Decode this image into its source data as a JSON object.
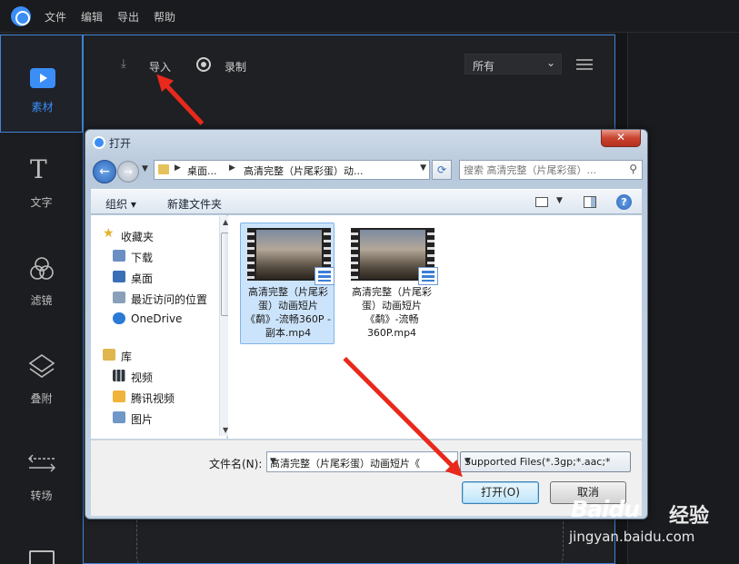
{
  "menubar": {
    "items": [
      "文件",
      "编辑",
      "导出",
      "帮助"
    ]
  },
  "sidebar": {
    "items": [
      {
        "label": "素材",
        "icon": "material-icon",
        "active": true
      },
      {
        "label": "文字",
        "icon": "text-icon"
      },
      {
        "label": "滤镜",
        "icon": "filter-icon"
      },
      {
        "label": "叠附",
        "icon": "overlay-icon"
      },
      {
        "label": "转场",
        "icon": "transition-icon"
      }
    ]
  },
  "toolbar": {
    "import_label": "导入",
    "record_label": "录制",
    "filter_value": "所有"
  },
  "dialog": {
    "title": "打开",
    "close_label": "✕",
    "address": {
      "crumb1": "桌面...",
      "crumb2": "高清完整（片尾彩蛋）动..."
    },
    "search_placeholder": "搜索 高清完整（片尾彩蛋）...",
    "commands": {
      "organize": "组织 ▾",
      "new_folder": "新建文件夹"
    },
    "nav": {
      "favorites": "收藏夹",
      "downloads": "下载",
      "desktop": "桌面",
      "recent": "最近访问的位置",
      "onedrive": "OneDrive",
      "libraries": "库",
      "videos": "视频",
      "tencent_video": "腾讯视频",
      "pictures": "图片"
    },
    "files": [
      {
        "name": "高清完整（片尾彩蛋）动画短片《鹬》-流畅360P - 副本.mp4",
        "selected": true
      },
      {
        "name": "高清完整（片尾彩蛋）动画短片《鹬》-流畅360P.mp4",
        "selected": false
      }
    ],
    "filename_label": "文件名(N):",
    "filename_value": "高清完整（片尾彩蛋）动画短片《",
    "filetype_value": "Supported Files(*.3gp;*.aac;*",
    "open_label": "打开(O)",
    "cancel_label": "取消"
  },
  "watermark": {
    "brand": "Baidu",
    "jingyan": "经验",
    "url": "jingyan.baidu.com"
  },
  "colors": {
    "accent": "#3a8ef6",
    "arrow": "#e8291c",
    "selection": "#cce4fb"
  }
}
